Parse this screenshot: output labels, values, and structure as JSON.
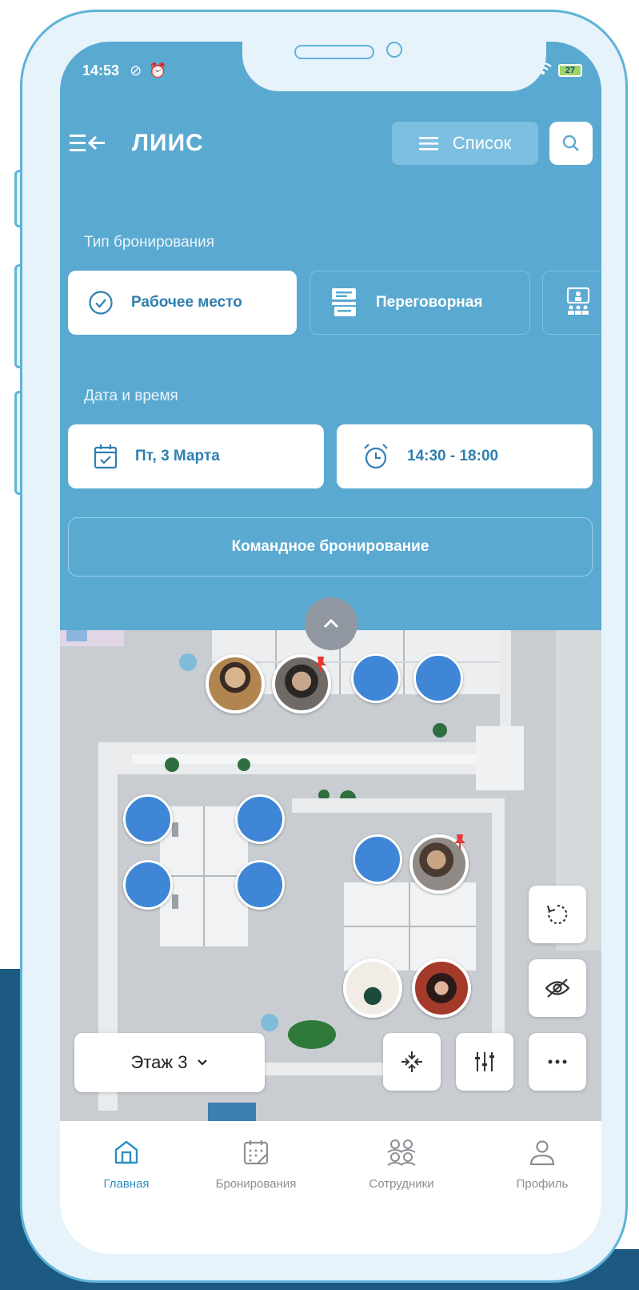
{
  "status_bar": {
    "time": "14:53",
    "battery": "27"
  },
  "header": {
    "title": "ЛИИС",
    "list_label": "Список"
  },
  "booking_type": {
    "label": "Тип бронирования",
    "options": [
      {
        "label": "Рабочее место",
        "active": true
      },
      {
        "label": "Переговорная",
        "active": false
      }
    ]
  },
  "datetime": {
    "label": "Дата и время",
    "date": "Пт, 3 Марта",
    "time": "14:30 - 18:00"
  },
  "team_booking_label": "Командное бронирование",
  "floor": {
    "label": "Этаж 3"
  },
  "colors": {
    "primary": "#5aa9d1",
    "accent": "#2f7fb0",
    "seat": "#3f86d6",
    "pin": "#e53935"
  },
  "tabs": [
    {
      "label": "Главная",
      "active": true
    },
    {
      "label": "Бронирования",
      "active": false
    },
    {
      "label": "Сотрудники",
      "active": false
    },
    {
      "label": "Профиль",
      "active": false
    }
  ]
}
